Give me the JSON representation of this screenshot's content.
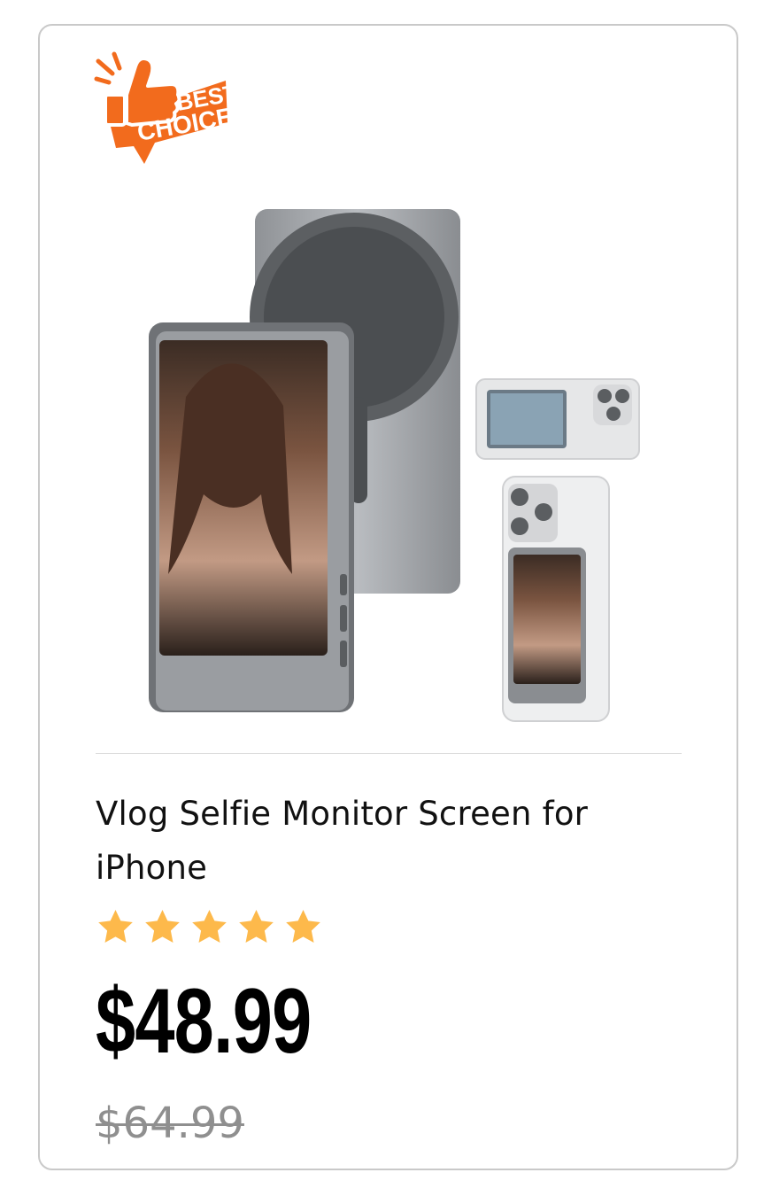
{
  "badge": {
    "line1": "BEST",
    "line2": "CHOICE",
    "color": "#f26b1d",
    "icon": "thumbs-up-icon"
  },
  "product": {
    "image_label": "product-image",
    "title": "Vlog Selfie Monitor Screen for iPhone",
    "rating": 5,
    "rating_max": 5,
    "star_color": "#fdb94b",
    "price": "$48.99",
    "original_price": "$64.99"
  }
}
